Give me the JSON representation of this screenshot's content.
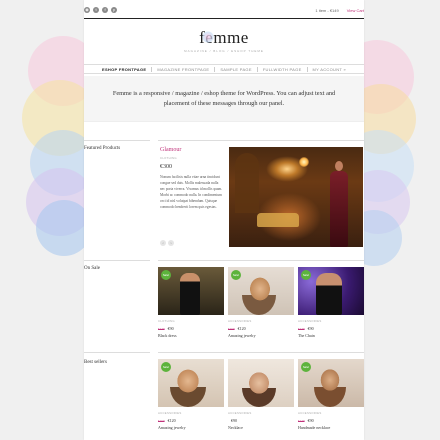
{
  "topbar": {
    "social_icons": [
      "rss-icon",
      "twitter-icon",
      "facebook-icon",
      "pinterest-icon"
    ],
    "cart_summary": "1 item - €149",
    "view_cart": "View Cart"
  },
  "logo": {
    "title": "femme",
    "subtitle": "MAGAZINE / BLOG / ESHOP THEME"
  },
  "nav": {
    "items": [
      {
        "label": "ESHOP FRONTPAGE",
        "active": true
      },
      {
        "label": "MAGAZINE FRONTPAGE",
        "active": false
      },
      {
        "label": "SAMPLE PAGE",
        "active": false
      },
      {
        "label": "FULLWIDTH PAGE",
        "active": false
      },
      {
        "label": "MY ACCOUNT »",
        "active": false
      }
    ]
  },
  "hero": {
    "text": "Femme is a responsive / magazine / eshop theme for WordPress. You can adjust text and placement of these messages through our panel."
  },
  "featured": {
    "section_title": "Featured Products",
    "product_title": "Glamour",
    "category": "CLOTHING",
    "price": "€300",
    "description": "Nonum facilisis nulla vitae urna tincidunt congue sed duis. Mollis malesuada nulla nec porta viverra. Vivamus id mollis quam. Morbi ac commodo nulla. In condimentum orci id nisl volutpat bibendum. Quisque commodo hendrerit lorem quis egestas.",
    "arrows": [
      "‹",
      "›"
    ]
  },
  "on_sale": {
    "section_title": "On Sale",
    "products": [
      {
        "badge": "Sale!",
        "category": "CLOTHING",
        "old_price": "€120",
        "price": "€90",
        "name": "Black dress"
      },
      {
        "badge": "Sale!",
        "category": "ACCESSORIES",
        "old_price": "€150",
        "price": "€120",
        "name": "Amazing jewelry"
      },
      {
        "badge": "Sale!",
        "category": "ACCESSORIES",
        "old_price": "€120",
        "price": "€90",
        "name": "The Chain"
      }
    ]
  },
  "best_sellers": {
    "section_title": "Best sellers",
    "products": [
      {
        "badge": "Sale!",
        "category": "ACCESSORIES",
        "old_price": "€150",
        "price": "€120",
        "name": "Amazing jewelry"
      },
      {
        "badge": "",
        "category": "ACCESSORIES",
        "old_price": "",
        "price": "€90",
        "name": "Necklace"
      },
      {
        "badge": "Sale!",
        "category": "ACCESSORIES",
        "old_price": "€120",
        "price": "€90",
        "name": "Handmade necklace"
      }
    ]
  },
  "colors": {
    "accent": "#c0327a",
    "sale_badge": "#5db33c"
  }
}
